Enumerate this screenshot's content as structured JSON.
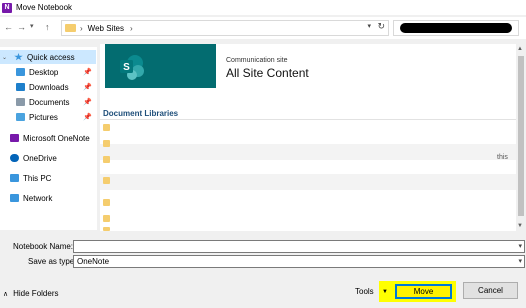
{
  "window": {
    "title": "Move Notebook"
  },
  "address": {
    "path": "Web Sites"
  },
  "sidebar": {
    "items": [
      {
        "label": "Quick access",
        "icon": "star-icon",
        "color": "#3a96dd"
      },
      {
        "label": "Desktop",
        "icon": "desktop-icon",
        "color": "#3a96dd"
      },
      {
        "label": "Downloads",
        "icon": "download-icon",
        "color": "#1e7fcb"
      },
      {
        "label": "Documents",
        "icon": "documents-icon",
        "color": "#8a9aa9"
      },
      {
        "label": "Pictures",
        "icon": "pictures-icon",
        "color": "#4aa3df"
      },
      {
        "label": "Microsoft OneNote",
        "icon": "onenote-icon",
        "color": "#7719aa"
      },
      {
        "label": "OneDrive",
        "icon": "onedrive-icon",
        "color": "#0364b8"
      },
      {
        "label": "This PC",
        "icon": "pc-icon",
        "color": "#3a96dd"
      },
      {
        "label": "Network",
        "icon": "network-icon",
        "color": "#3a96dd"
      }
    ]
  },
  "site": {
    "subtitle": "Communication site",
    "title": "All Site Content",
    "banner_color": "#036c70"
  },
  "content": {
    "section_title": "Document Libraries",
    "stray_text": "this"
  },
  "form": {
    "name_label": "Notebook Name:",
    "name_value": "",
    "type_label": "Save as type:",
    "type_value": "OneNote"
  },
  "footer": {
    "hide_folders": "Hide Folders",
    "tools": "Tools",
    "move": "Move",
    "cancel": "Cancel",
    "highlight_color": "#ffff00"
  }
}
